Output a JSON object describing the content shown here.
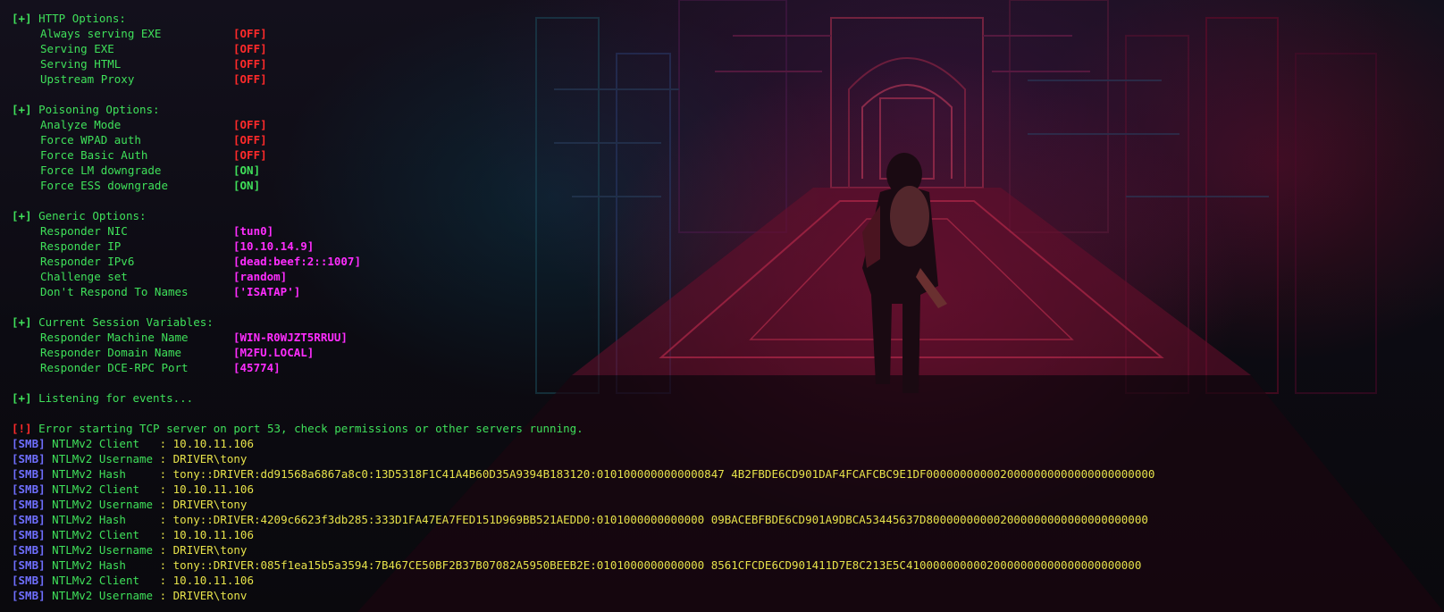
{
  "http_options": {
    "header_tag": "[+]",
    "header": "HTTP Options:",
    "items": [
      {
        "label": "Always serving EXE",
        "value": "[OFF]",
        "color": "#ff2a2a"
      },
      {
        "label": "Serving EXE",
        "value": "[OFF]",
        "color": "#ff2a2a"
      },
      {
        "label": "Serving HTML",
        "value": "[OFF]",
        "color": "#ff2a2a"
      },
      {
        "label": "Upstream Proxy",
        "value": "[OFF]",
        "color": "#ff2a2a"
      }
    ]
  },
  "poisoning_options": {
    "header_tag": "[+]",
    "header": "Poisoning Options:",
    "items": [
      {
        "label": "Analyze Mode",
        "value": "[OFF]",
        "color": "#ff2a2a"
      },
      {
        "label": "Force WPAD auth",
        "value": "[OFF]",
        "color": "#ff2a2a"
      },
      {
        "label": "Force Basic Auth",
        "value": "[OFF]",
        "color": "#ff2a2a"
      },
      {
        "label": "Force LM downgrade",
        "value": "[ON]",
        "color": "#3fe05a"
      },
      {
        "label": "Force ESS downgrade",
        "value": "[ON]",
        "color": "#3fe05a"
      }
    ]
  },
  "generic_options": {
    "header_tag": "[+]",
    "header": "Generic Options:",
    "items": [
      {
        "label": "Responder NIC",
        "value": "[tun0]"
      },
      {
        "label": "Responder IP",
        "value": "[10.10.14.9]"
      },
      {
        "label": "Responder IPv6",
        "value": "[dead:beef:2::1007]"
      },
      {
        "label": "Challenge set",
        "value": "[random]"
      },
      {
        "label": "Don't Respond To Names",
        "value": "['ISATAP']"
      }
    ]
  },
  "session_variables": {
    "header_tag": "[+]",
    "header": "Current Session Variables:",
    "items": [
      {
        "label": "Responder Machine Name",
        "value": "[WIN-R0WJZT5RRUU]"
      },
      {
        "label": "Responder Domain Name",
        "value": "[M2FU.LOCAL]"
      },
      {
        "label": "Responder DCE-RPC Port",
        "value": "[45774]"
      }
    ]
  },
  "listening": {
    "tag": "[+]",
    "text": "Listening for events..."
  },
  "error": {
    "tag": "[!]",
    "text": "Error starting TCP server on port 53, check permissions or other servers running."
  },
  "smb_log": [
    {
      "tag": "[SMB]",
      "field": "NTLMv2 Client  ",
      "sep": ":",
      "value": "10.10.11.106"
    },
    {
      "tag": "[SMB]",
      "field": "NTLMv2 Username",
      "sep": ":",
      "value": "DRIVER\\tony"
    },
    {
      "tag": "[SMB]",
      "field": "NTLMv2 Hash    ",
      "sep": ":",
      "value": "tony::DRIVER:dd91568a6867a8c0:13D5318F1C41A4B60D35A9394B183120:0101000000000000847 4B2FBDE6CD901DAF4FCAFCBC9E1DF0000000000020000000000000000000000"
    },
    {
      "tag": "[SMB]",
      "field": "NTLMv2 Client  ",
      "sep": ":",
      "value": "10.10.11.106"
    },
    {
      "tag": "[SMB]",
      "field": "NTLMv2 Username",
      "sep": ":",
      "value": "DRIVER\\tony"
    },
    {
      "tag": "[SMB]",
      "field": "NTLMv2 Hash    ",
      "sep": ":",
      "value": "tony::DRIVER:4209c6623f3db285:333D1FA47EA7FED151D969BB521AEDD0:0101000000000000 09BACEBFBDE6CD901A9DBCA53445637D800000000002000000000000000000000"
    },
    {
      "tag": "[SMB]",
      "field": "NTLMv2 Client  ",
      "sep": ":",
      "value": "10.10.11.106"
    },
    {
      "tag": "[SMB]",
      "field": "NTLMv2 Username",
      "sep": ":",
      "value": "DRIVER\\tony"
    },
    {
      "tag": "[SMB]",
      "field": "NTLMv2 Hash    ",
      "sep": ":",
      "value": "tony::DRIVER:085f1ea15b5a3594:7B467CE50BF2B37B07082A5950BEEB2E:0101000000000000 8561CFCDE6CD901411D7E8C213E5C41000000000020000000000000000000000"
    },
    {
      "tag": "[SMB]",
      "field": "NTLMv2 Client  ",
      "sep": ":",
      "value": "10.10.11.106"
    },
    {
      "tag": "[SMB]",
      "field": "NTLMv2 Username",
      "sep": ":",
      "value": "DRIVER\\tonv"
    }
  ]
}
